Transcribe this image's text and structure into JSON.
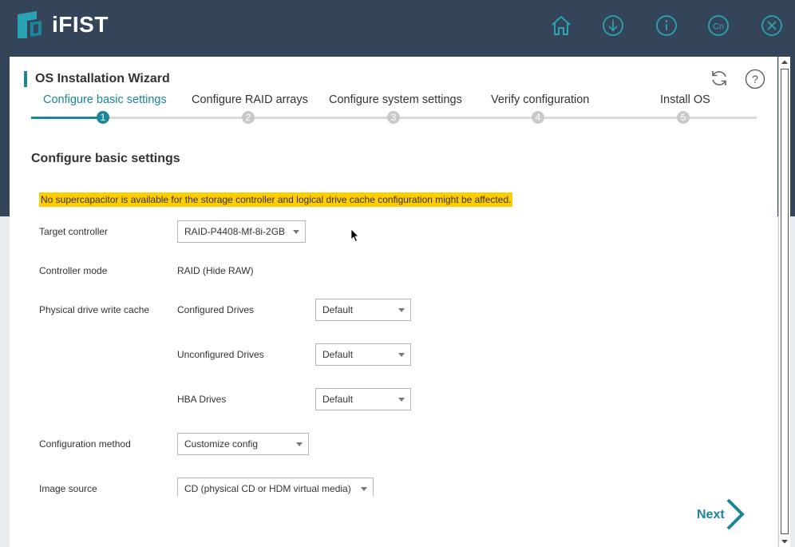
{
  "app": {
    "name": "iFIST",
    "icons": [
      "home-icon",
      "download-icon",
      "info-icon",
      "language-icon",
      "close-icon"
    ],
    "language_label": "Cn"
  },
  "wizard": {
    "title": "OS Installation Wizard",
    "steps": [
      {
        "label": "Configure basic settings",
        "number": "1",
        "active": true
      },
      {
        "label": "Configure RAID arrays",
        "number": "2",
        "active": false
      },
      {
        "label": "Configure system settings",
        "number": "3",
        "active": false
      },
      {
        "label": "Verify configuration",
        "number": "4",
        "active": false
      },
      {
        "label": "Install OS",
        "number": "5",
        "active": false
      }
    ],
    "help_label": "?"
  },
  "form": {
    "section_title": "Configure basic settings",
    "warning": "No supercapacitor is available for the storage controller and logical drive cache configuration might be affected.",
    "target_controller": {
      "label": "Target controller",
      "value": "RAID-P4408-Mf-8i-2GB"
    },
    "controller_mode": {
      "label": "Controller mode",
      "value": "RAID (Hide RAW)"
    },
    "write_cache": {
      "label": "Physical drive write cache",
      "configured": {
        "label": "Configured Drives",
        "value": "Default"
      },
      "unconfigured": {
        "label": "Unconfigured Drives",
        "value": "Default"
      },
      "hba": {
        "label": "HBA Drives",
        "value": "Default"
      }
    },
    "config_method": {
      "label": "Configuration method",
      "value": "Customize config"
    },
    "image_source": {
      "label": "Image source",
      "value": "CD (physical CD or HDM virtual media)"
    }
  },
  "footer": {
    "next_label": "Next"
  },
  "colors": {
    "accent": "#1b8599",
    "header": "#354559",
    "warning": "#ffcc00"
  }
}
